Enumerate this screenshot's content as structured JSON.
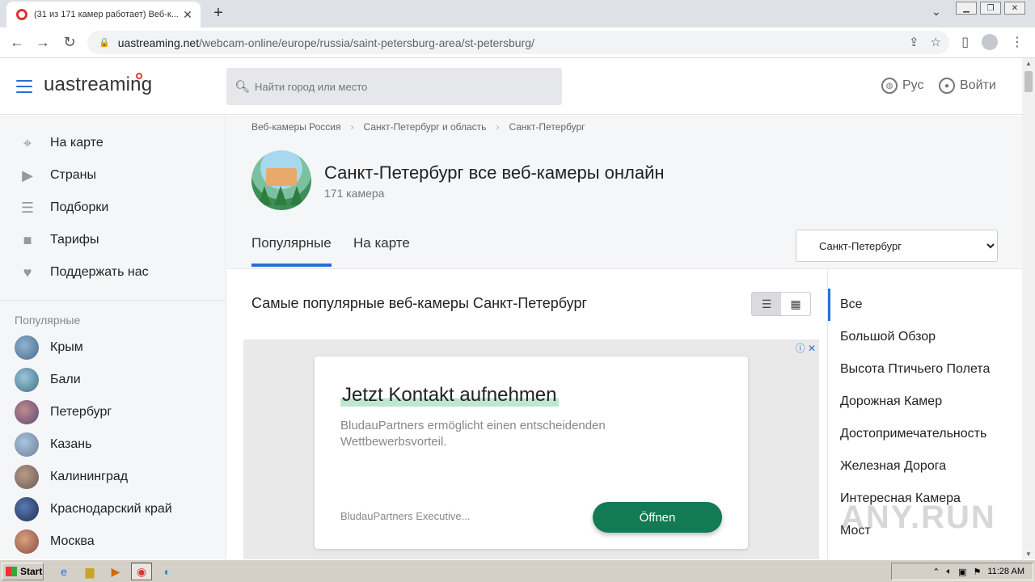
{
  "browser": {
    "tab_title": "(31 из 171 камер работает) Веб-к...",
    "url_host": "uastreaming.net",
    "url_path": "/webcam-online/europe/russia/saint-petersburg-area/st-petersburg/"
  },
  "header": {
    "logo": "uastreaming",
    "search_placeholder": "Найти город или место",
    "lang_label": "Рус",
    "login_label": "Войти"
  },
  "sidebar": {
    "menu": [
      {
        "label": "На карте",
        "icon": "map-pin-icon"
      },
      {
        "label": "Страны",
        "icon": "tv-icon"
      },
      {
        "label": "Подборки",
        "icon": "list-icon"
      },
      {
        "label": "Тарифы",
        "icon": "briefcase-icon"
      },
      {
        "label": "Поддержать нас",
        "icon": "heart-icon"
      }
    ],
    "popular_heading": "Популярные",
    "popular": [
      {
        "label": "Крым"
      },
      {
        "label": "Бали"
      },
      {
        "label": "Петербург"
      },
      {
        "label": "Казань"
      },
      {
        "label": "Калининград"
      },
      {
        "label": "Краснодарский край"
      },
      {
        "label": "Москва"
      }
    ]
  },
  "breadcrumbs": [
    "Веб-камеры Россия",
    "Санкт-Петербург и область",
    "Санкт-Петербург"
  ],
  "hero": {
    "title": "Санкт-Петербург все веб-камеры онлайн",
    "count": "171 камера"
  },
  "tabs": {
    "popular": "Популярные",
    "map": "На карте",
    "city_select": "Санкт-Петербург"
  },
  "content": {
    "section_title": "Самые популярные веб-камеры Санкт-Петербург"
  },
  "ad": {
    "headline": "Jetzt Kontakt aufnehmen",
    "body": "BludauPartners ermöglicht einen entscheidenden Wettbewerbsvorteil.",
    "source": "BludauPartners Executive...",
    "cta": "Öffnen"
  },
  "categories": [
    "Все",
    "Большой Обзор",
    "Высота Птичьего Полета",
    "Дорожная Камер",
    "Достопримечательность",
    "Железная Дорога",
    "Интересная Камера",
    "Мост"
  ],
  "taskbar": {
    "start_label": "Start",
    "clock": "11:28 AM"
  },
  "watermark": "ANY.RUN"
}
